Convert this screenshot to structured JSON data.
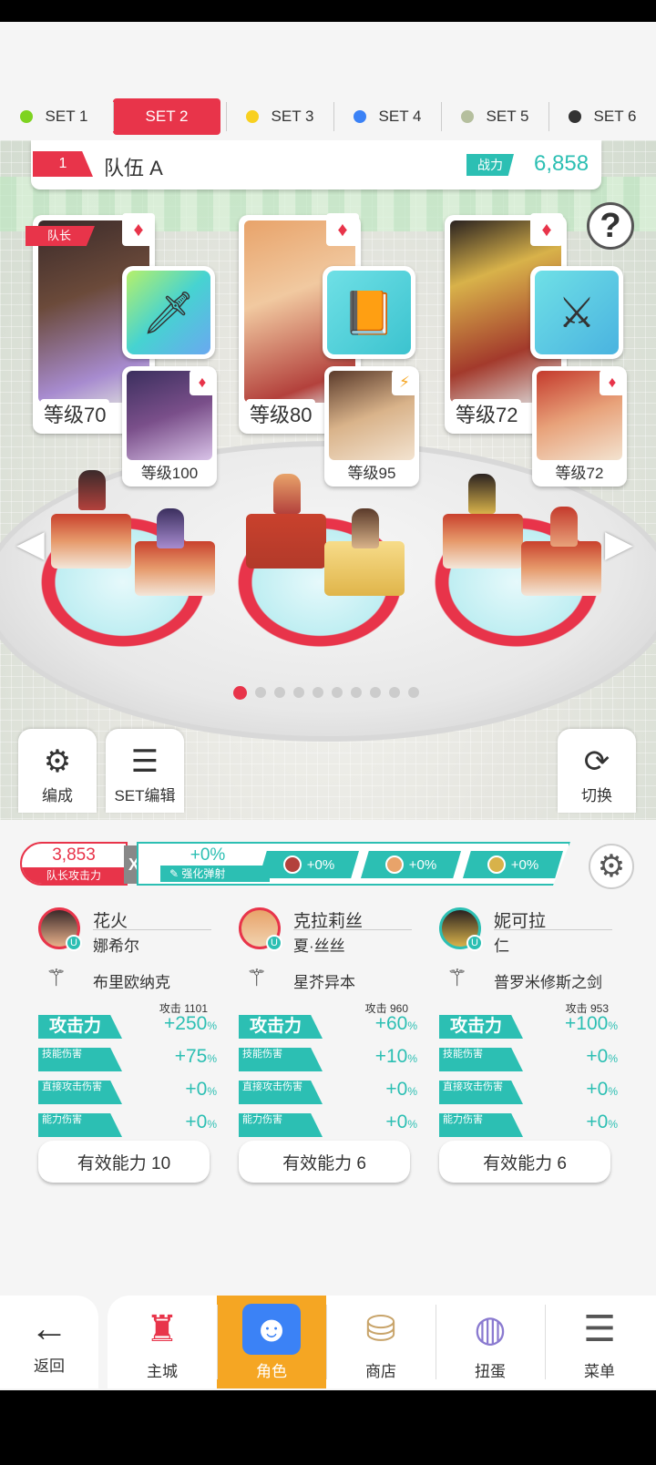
{
  "set_tabs": [
    {
      "label": "SET 1",
      "color": "#7ed321",
      "active": false
    },
    {
      "label": "SET 2",
      "color": "#e8344a",
      "active": true
    },
    {
      "label": "SET 3",
      "color": "#f8d020",
      "active": false
    },
    {
      "label": "SET 4",
      "color": "#3b82f6",
      "active": false
    },
    {
      "label": "SET 5",
      "color": "#b5bf9e",
      "active": false
    },
    {
      "label": "SET 6",
      "color": "#333333",
      "active": false
    }
  ],
  "team": {
    "number": "1",
    "name": "队伍 A",
    "power_label": "战力",
    "power_value": "6,858"
  },
  "heroes": [
    {
      "leader_tag": "队长",
      "level": "等级70",
      "sub_level": "等级100",
      "suit": "♦"
    },
    {
      "level": "等级80",
      "sub_level": "等级95",
      "suit": "♦"
    },
    {
      "level": "等级72",
      "sub_level": "等级72",
      "suit": "♦"
    }
  ],
  "tools": {
    "formation": "编成",
    "set_edit": "SET编辑",
    "switch": "切换"
  },
  "leader_attack": {
    "value": "3,853",
    "label": "队长攻击力"
  },
  "boost": {
    "value": "+0%",
    "label": "强化弹射",
    "chips": [
      "+0%",
      "+0%",
      "+0%"
    ]
  },
  "characters": [
    {
      "name": "花火",
      "subname": "娜希尔",
      "weapon": "布里欧纳克",
      "attack_base": "攻击  1101",
      "stats": [
        {
          "label": "攻击力",
          "value": "+250"
        },
        {
          "label": "技能伤害",
          "value": "+75"
        },
        {
          "label": "直接攻击伤害",
          "value": "+0"
        },
        {
          "label": "能力伤害",
          "value": "+0"
        }
      ],
      "effective": "有效能力 10"
    },
    {
      "name": "克拉莉丝",
      "subname": "夏·丝丝",
      "weapon": "星芥异本",
      "attack_base": "攻击    960",
      "stats": [
        {
          "label": "攻击力",
          "value": "+60"
        },
        {
          "label": "技能伤害",
          "value": "+10"
        },
        {
          "label": "直接攻击伤害",
          "value": "+0"
        },
        {
          "label": "能力伤害",
          "value": "+0"
        }
      ],
      "effective": "有效能力 6"
    },
    {
      "name": "妮可拉",
      "subname": "仁",
      "weapon": "普罗米修斯之剑",
      "attack_base": "攻击    953",
      "stats": [
        {
          "label": "攻击力",
          "value": "+100"
        },
        {
          "label": "技能伤害",
          "value": "+0"
        },
        {
          "label": "直接攻击伤害",
          "value": "+0"
        },
        {
          "label": "能力伤害",
          "value": "+0"
        }
      ],
      "effective": "有效能力 6"
    }
  ],
  "percent_sign": "%",
  "nav": {
    "back": "返回",
    "items": [
      "主城",
      "角色",
      "商店",
      "扭蛋",
      "菜单"
    ],
    "active_index": 1
  },
  "page_dots": {
    "count": 10,
    "active": 0
  },
  "icons": [
    "help-icon",
    "formation-icon",
    "list-icon",
    "switch-icon",
    "gear-icon",
    "weapon-icon",
    "back-arrow-icon",
    "castle-icon",
    "character-icon",
    "shop-icon",
    "gacha-icon",
    "menu-icon"
  ],
  "colors": {
    "accent_red": "#e8344a",
    "teal": "#2cbfb3",
    "nav_active": "#f5a623"
  }
}
